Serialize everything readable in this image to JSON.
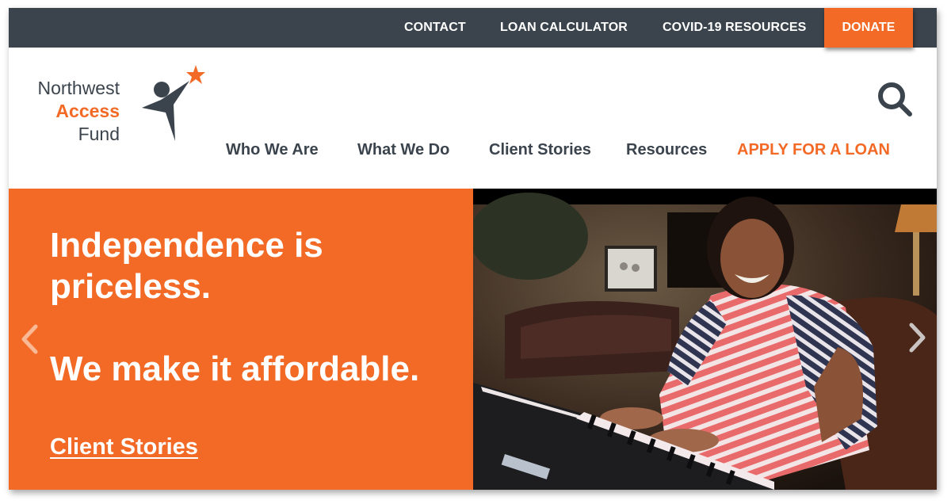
{
  "topbar": {
    "links": [
      {
        "label": "CONTACT"
      },
      {
        "label": "LOAN CALCULATOR"
      },
      {
        "label": "COVID-19 RESOURCES"
      }
    ],
    "donate_label": "DONATE"
  },
  "logo": {
    "line1": "Northwest",
    "line2": "Access",
    "line3": "Fund",
    "icon": "reaching-star-figure-icon"
  },
  "search": {
    "icon": "search-icon"
  },
  "nav": {
    "items": [
      {
        "label": "Who We Are"
      },
      {
        "label": "What We Do"
      },
      {
        "label": "Client Stories"
      },
      {
        "label": "Resources"
      },
      {
        "label": "APPLY FOR A LOAN"
      }
    ]
  },
  "hero": {
    "headline_1": "Independence is priceless.",
    "headline_2": "We make it affordable.",
    "link_label": "Client Stories",
    "prev_icon": "chevron-left-icon",
    "next_icon": "chevron-right-icon",
    "image_alt": "Smiling woman playing an electronic keyboard"
  },
  "colors": {
    "brand_orange": "#f26a26",
    "brand_slate": "#3b444d",
    "white": "#ffffff"
  }
}
